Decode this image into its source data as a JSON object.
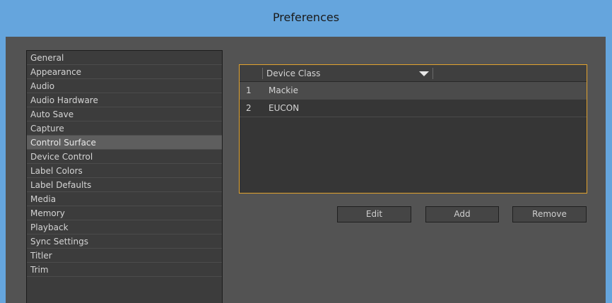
{
  "window": {
    "title": "Preferences"
  },
  "sidebar": {
    "items": [
      {
        "label": "General"
      },
      {
        "label": "Appearance"
      },
      {
        "label": "Audio"
      },
      {
        "label": "Audio Hardware"
      },
      {
        "label": "Auto Save"
      },
      {
        "label": "Capture"
      },
      {
        "label": "Control Surface",
        "selected": true
      },
      {
        "label": "Device Control"
      },
      {
        "label": "Label Colors"
      },
      {
        "label": "Label Defaults"
      },
      {
        "label": "Media"
      },
      {
        "label": "Memory"
      },
      {
        "label": "Playback"
      },
      {
        "label": "Sync Settings"
      },
      {
        "label": "Titler"
      },
      {
        "label": "Trim"
      }
    ]
  },
  "device_table": {
    "column_header": "Device Class",
    "rows": [
      {
        "index": "1",
        "name": "Mackie",
        "selected": true
      },
      {
        "index": "2",
        "name": "EUCON",
        "selected": false
      }
    ]
  },
  "buttons": {
    "edit": "Edit",
    "add": "Add",
    "remove": "Remove"
  },
  "colors": {
    "title_bar": "#65a5dd",
    "panel_bg": "#535353",
    "table_focus_border": "#e2a32e",
    "selected_item": "#5e5e5e"
  },
  "icons": {
    "column_dropdown": "triangle-down-icon"
  }
}
